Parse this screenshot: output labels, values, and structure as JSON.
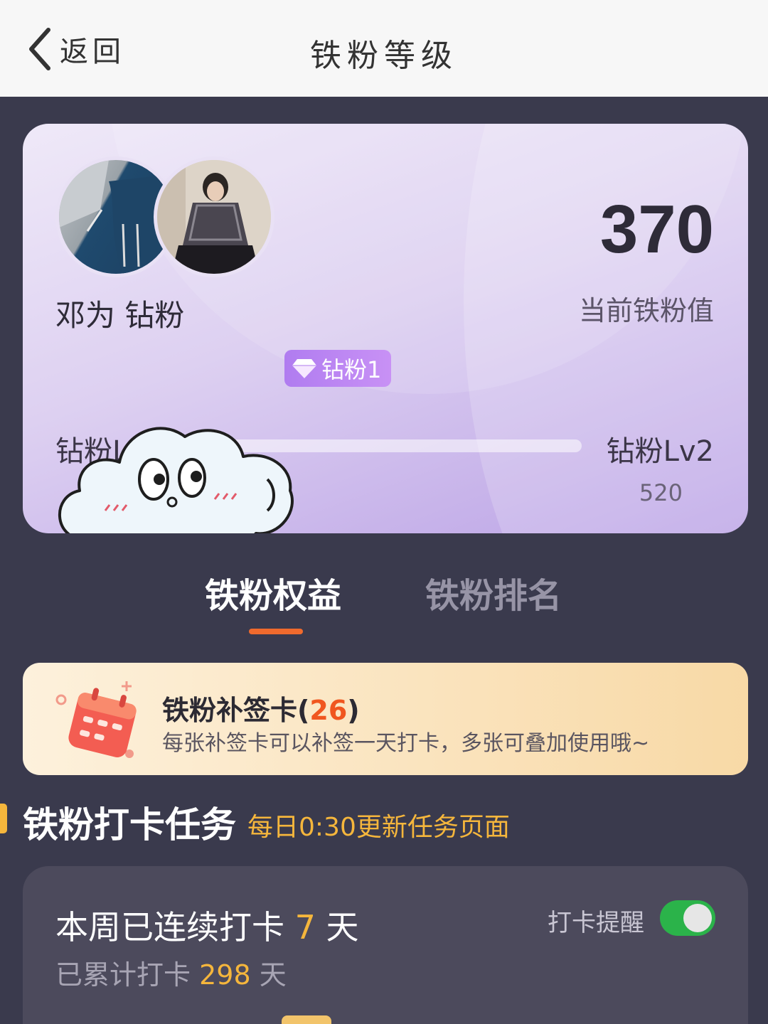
{
  "header": {
    "back_label": "返回",
    "title": "铁粉等级"
  },
  "level_card": {
    "score": "370",
    "score_label": "当前铁粉值",
    "fan_name": "邓为    钻粉",
    "badge": "钻粉1",
    "current_level": "钻粉Lv1",
    "next_level": "钻粉Lv2",
    "current_value": "370",
    "next_value": "520",
    "progress_fraction": 0.0
  },
  "tabs": [
    {
      "label": "铁粉权益",
      "active": true
    },
    {
      "label": "铁粉排名",
      "active": false
    }
  ],
  "makeup_card": {
    "title": "铁粉补签卡(",
    "count": "26",
    "title_end": ")",
    "desc": "每张补签卡可以补签一天打卡，多张可叠加使用哦~"
  },
  "checkin_section": {
    "title": "铁粉打卡任务",
    "subtitle": "每日0:30更新任务页面"
  },
  "checkin_card": {
    "streak_prefix": "本周已连续打卡 ",
    "streak_days": "7",
    "streak_suffix": " 天",
    "total_prefix": "已累计打卡 ",
    "total_days": "298",
    "total_suffix": " 天",
    "reminder_label": "打卡提醒",
    "reminder_on": true
  },
  "colors": {
    "accent_orange": "#f06a2d",
    "gold": "#f5b63c",
    "toggle_green": "#2bb34a",
    "badge_purple": "#b07cf0"
  }
}
